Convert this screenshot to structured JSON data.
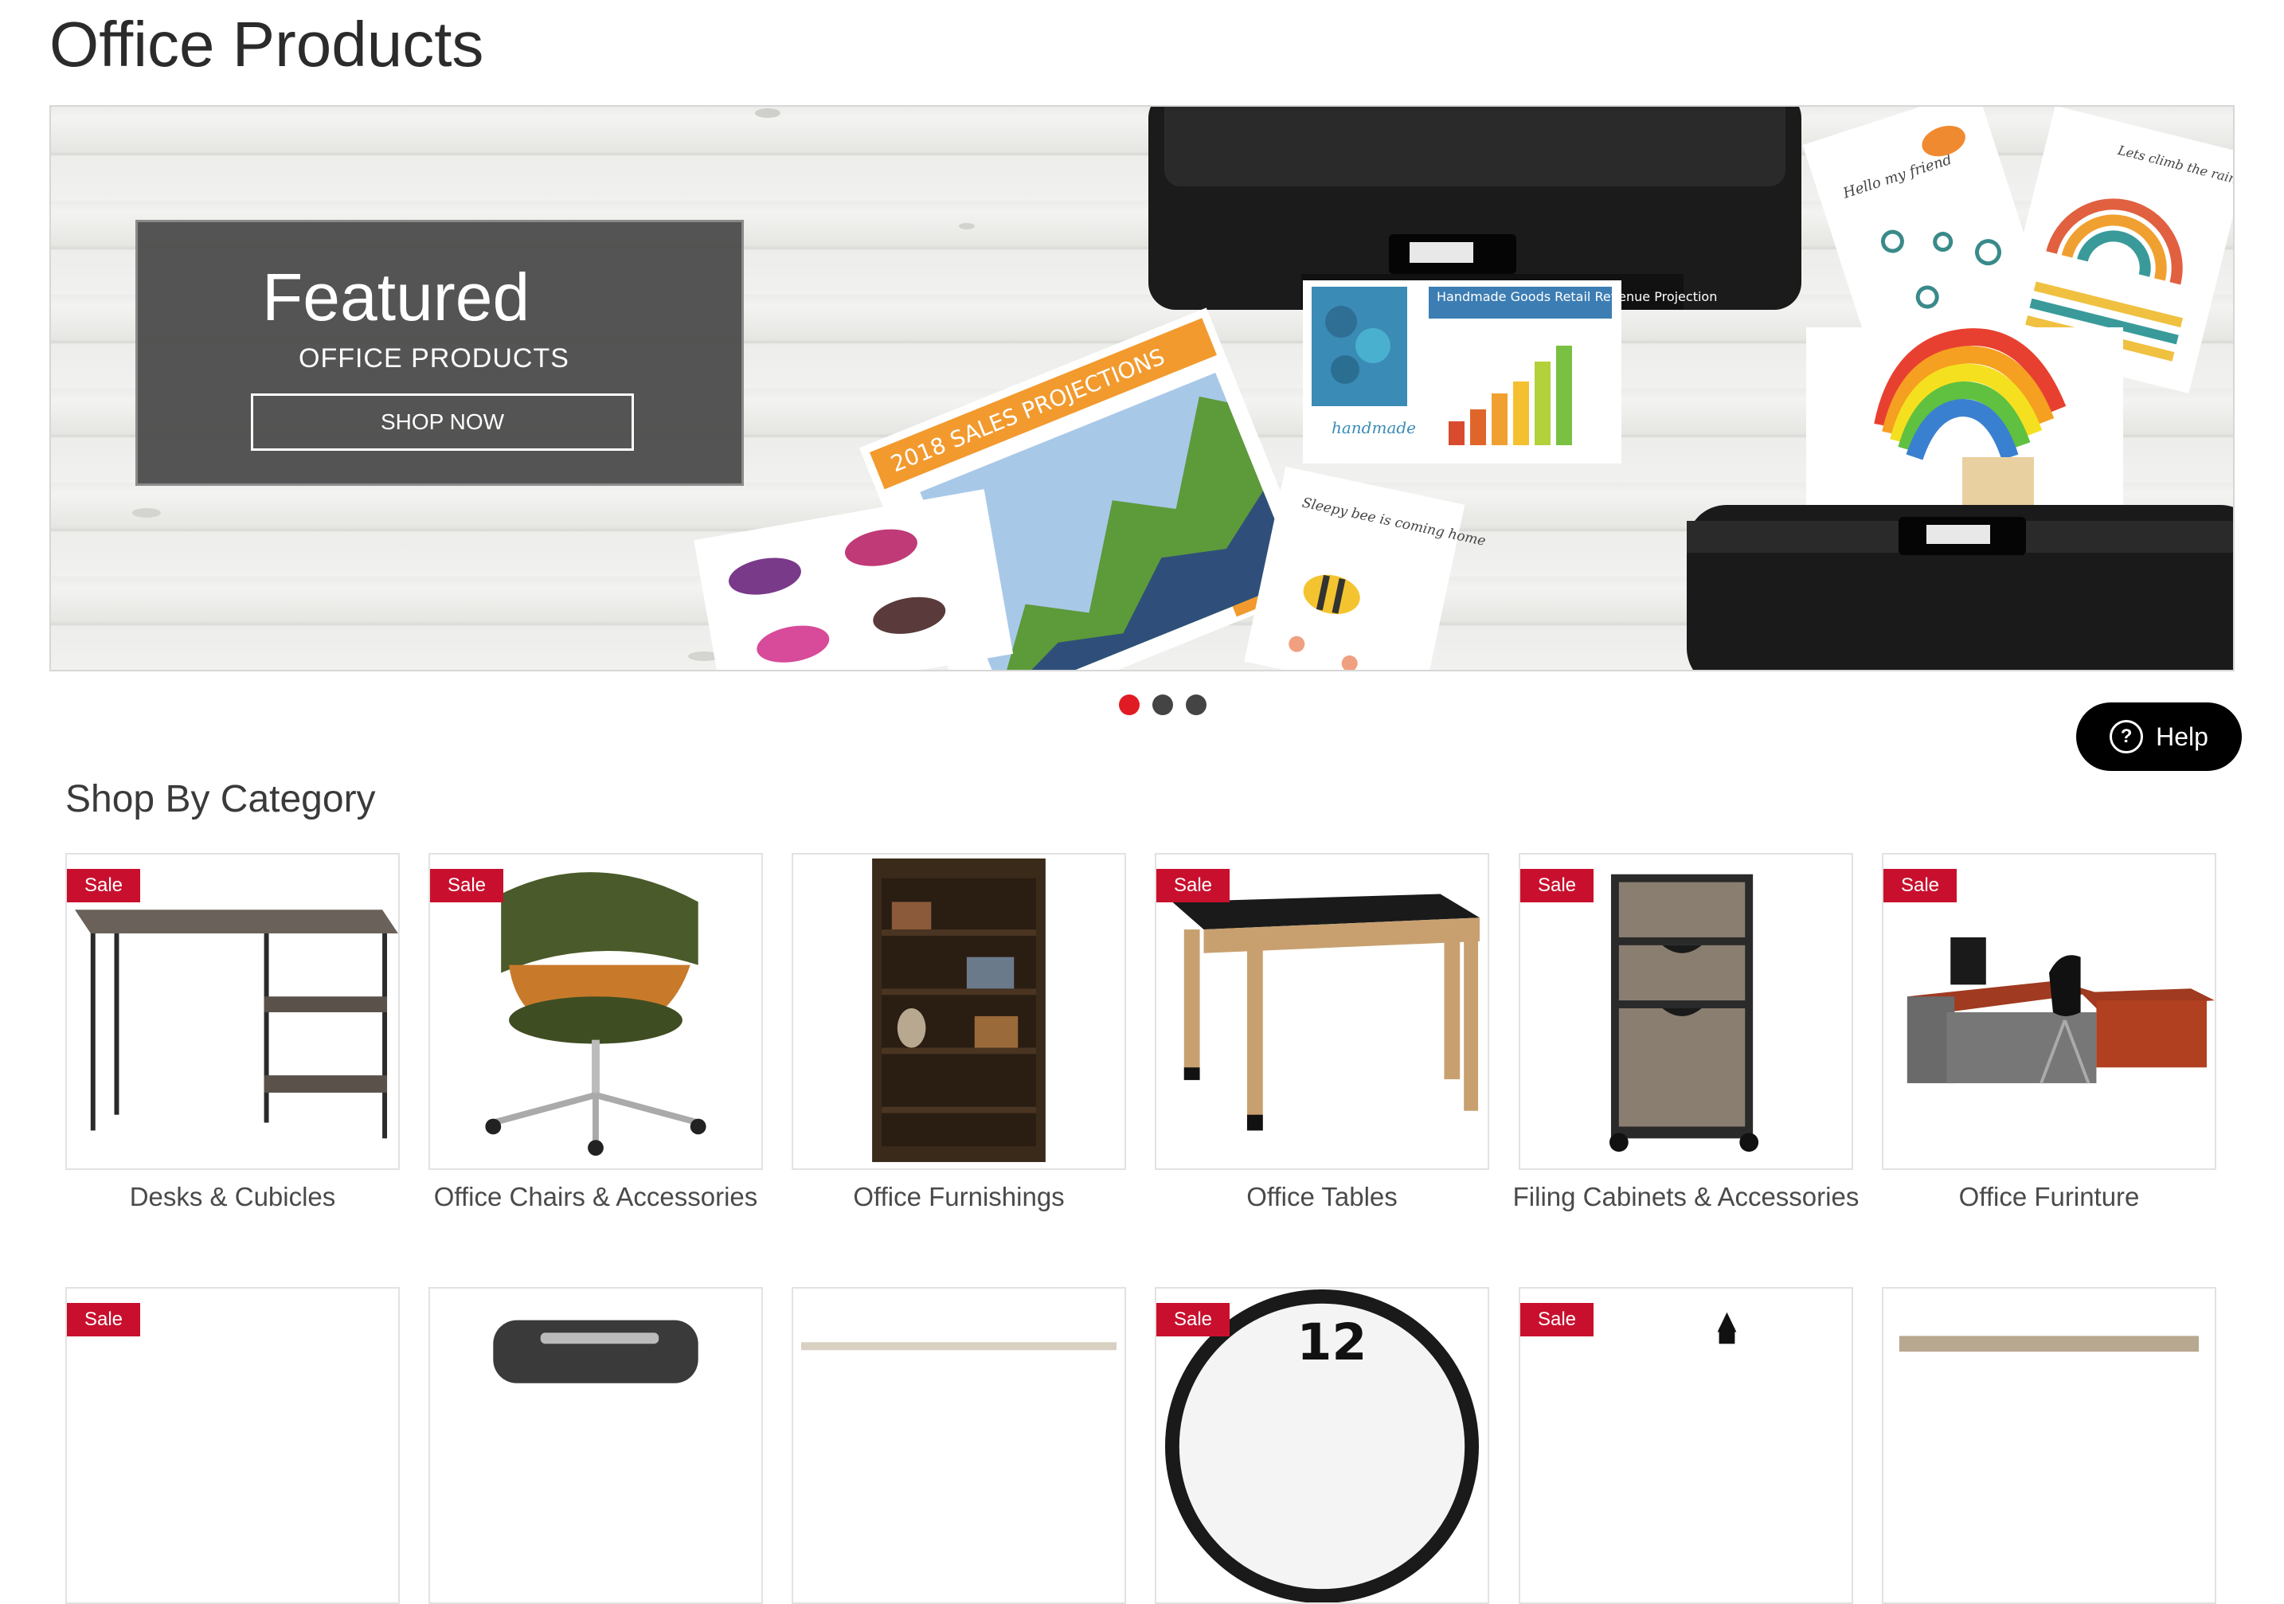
{
  "page": {
    "title": "Office Products"
  },
  "hero": {
    "title": "Featured",
    "subtitle": "OFFICE PRODUCTS",
    "button_label": "SHOP NOW",
    "slides": 3,
    "active_slide": 1,
    "art_text": {
      "sales_header": "2018 SALES PROJECTIONS",
      "handmade_title": "Handmade Goods Retail Revenue Projection",
      "handmade_logo": "handmade",
      "bee_card": "Sleepy bee is coming home",
      "friend_card": "Hello my friend",
      "rainbow_card": "Lets climb the rainbow"
    }
  },
  "help": {
    "label": "Help",
    "icon": "question-circle-icon"
  },
  "categories_section": {
    "title": "Shop By Category",
    "sale_label": "Sale",
    "row1": [
      {
        "label": "Desks & Cubicles",
        "sale": true,
        "icon": "desk"
      },
      {
        "label": "Office Chairs & Accessories",
        "sale": true,
        "icon": "chair"
      },
      {
        "label": "Office Furnishings",
        "sale": false,
        "icon": "bookcase"
      },
      {
        "label": "Office Tables",
        "sale": true,
        "icon": "table"
      },
      {
        "label": "Filing Cabinets & Accessories",
        "sale": true,
        "icon": "filing-cabinet"
      },
      {
        "label": "Office Furinture",
        "sale": true,
        "icon": "office-desk-set"
      }
    ],
    "row2": [
      {
        "sale": true,
        "icon": "product"
      },
      {
        "sale": false,
        "icon": "shredder"
      },
      {
        "sale": false,
        "icon": "product"
      },
      {
        "sale": true,
        "icon": "wall-clock",
        "clock_digits": "12"
      },
      {
        "sale": true,
        "icon": "product"
      },
      {
        "sale": false,
        "icon": "product"
      }
    ]
  },
  "colors": {
    "accent": "#e01b24",
    "sale": "#c8102e",
    "help_bg": "#000000"
  }
}
